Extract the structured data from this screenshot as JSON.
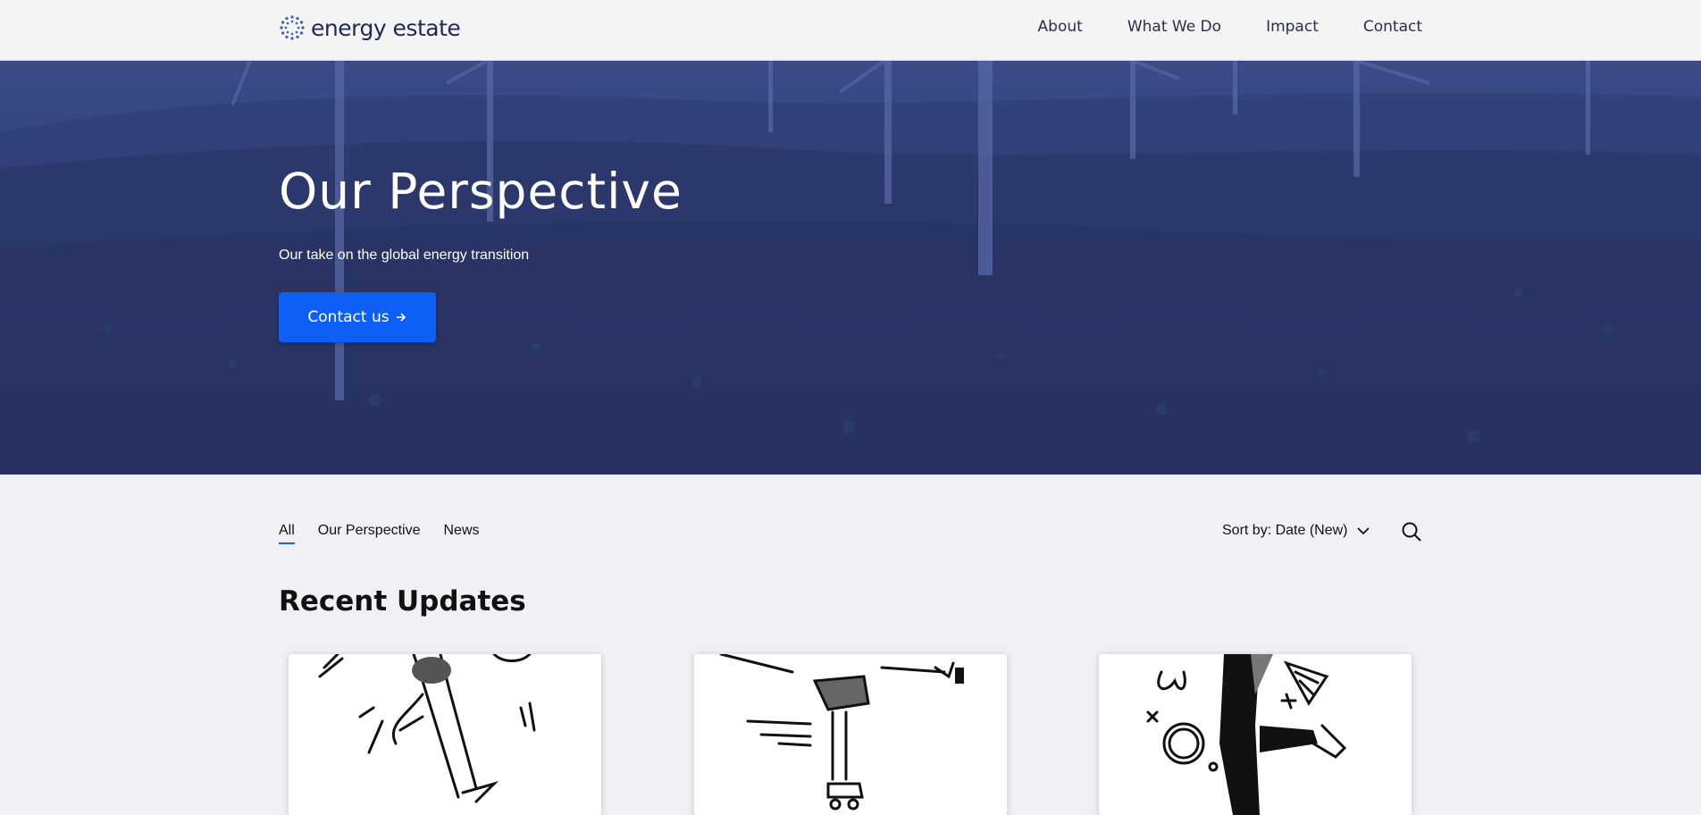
{
  "header": {
    "brand": "energy estate",
    "nav": [
      "About",
      "What We Do",
      "Impact",
      "Contact"
    ]
  },
  "hero": {
    "title": "Our Perspective",
    "subtitle": "Our take on the global energy transition",
    "cta_label": "Contact us",
    "cta_icon": "arrow-right-icon"
  },
  "filters": {
    "tabs": [
      "All",
      "Our Perspective",
      "News"
    ],
    "active_tab": "All",
    "sort_label": "Sort by: Date (New)",
    "sort_icon": "chevron-down-icon",
    "search_icon": "search-icon"
  },
  "section": {
    "title": "Recent Updates"
  },
  "colors": {
    "brand": "#1f2a52",
    "accent": "#0d5ff5",
    "hero_overlay": "#2f3b72"
  }
}
